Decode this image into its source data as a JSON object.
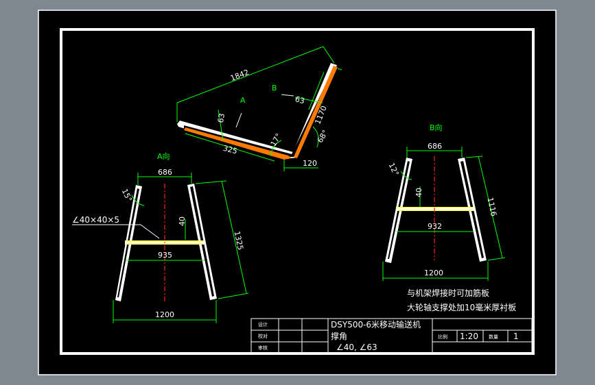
{
  "top_view": {
    "dim_total": "1842",
    "dim_63_a": "63",
    "dim_63_b": "63",
    "dim_325": "325",
    "dim_1170": "1170",
    "dim_120": "120",
    "angle_17": "17°",
    "angle_68": "68°",
    "label_a": "A",
    "label_b": "B"
  },
  "view_a": {
    "title": "A向",
    "dim_top": "686",
    "dim_angle": "15°",
    "dim_40": "40",
    "dim_935": "935",
    "dim_1325": "1325",
    "dim_bottom": "1200",
    "angle_steel": "∠40×40×5"
  },
  "view_b": {
    "title": "B向",
    "dim_top": "686",
    "dim_angle": "12°",
    "dim_40": "40",
    "dim_932": "932",
    "dim_1116": "1116",
    "dim_bottom": "1200"
  },
  "notes": {
    "line1": "与机架焊接时可加筋板",
    "line2": "大轮轴支撑处加10毫米厚衬板"
  },
  "title_block": {
    "design_label": "设计",
    "check_label": "校对",
    "review_label": "审核",
    "drawing_title": "DSY500-6米移动输送机",
    "part_name": "撑角",
    "materials": "∠40, ∠63",
    "scale_label": "比例",
    "scale_value": "1:20",
    "qty_label": "数量",
    "qty_value": "1"
  }
}
